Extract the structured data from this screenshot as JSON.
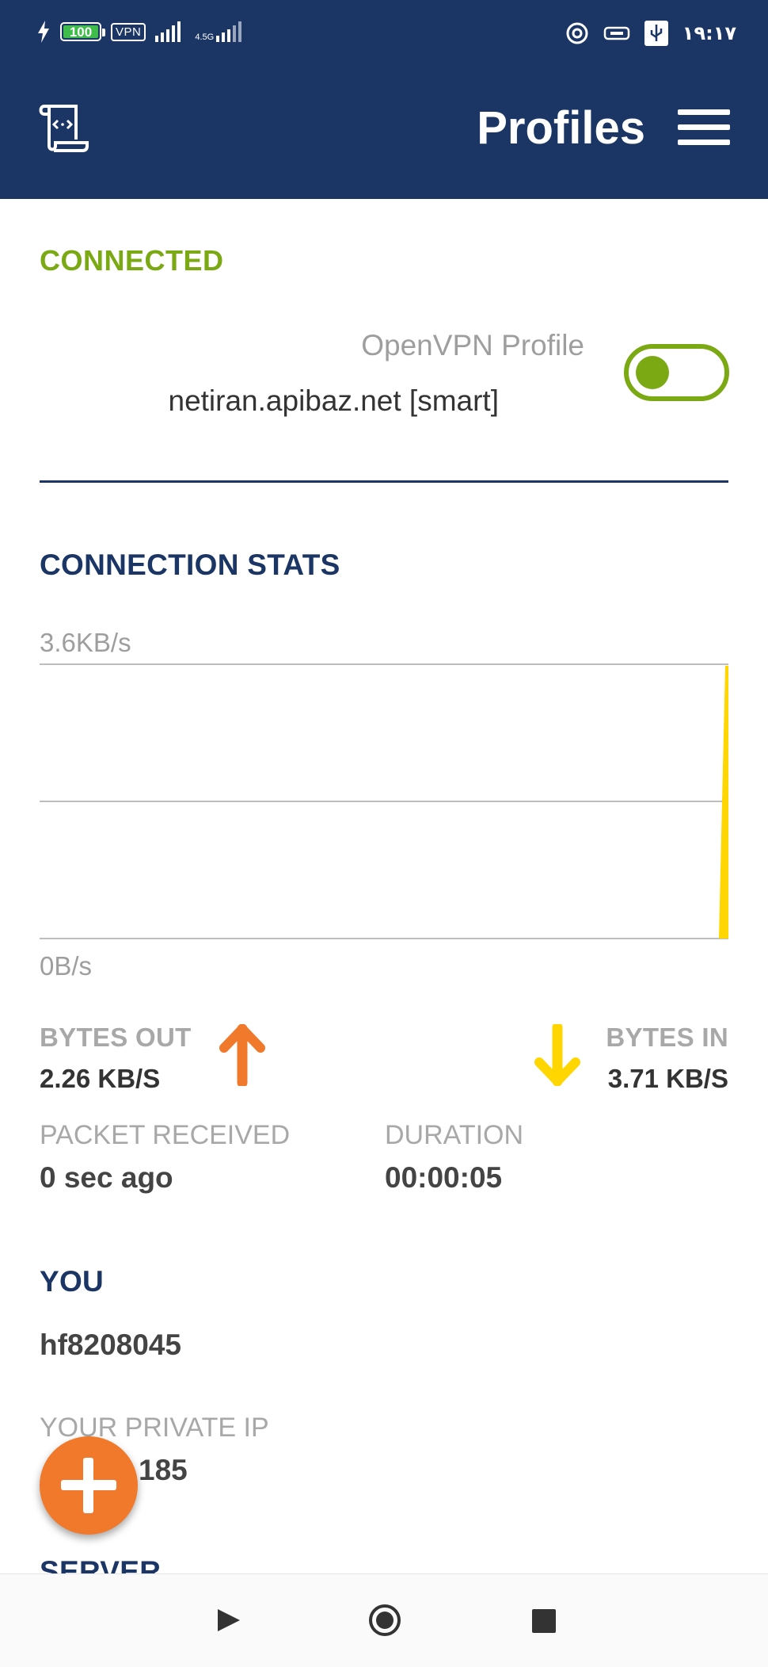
{
  "status_bar": {
    "battery": "100",
    "vpn_badge": "VPN",
    "network_label": "4.5G",
    "time": "١٩:١٧"
  },
  "header": {
    "title": "Profiles",
    "logo_icon": "scroll-code-icon",
    "menu_icon": "hamburger-menu-icon"
  },
  "connection": {
    "state": "CONNECTED",
    "profile_type": "OpenVPN Profile",
    "profile_name": "netiran.apibaz.net [smart]",
    "toggle_on": true,
    "accent_color": "#7aa913"
  },
  "stats": {
    "title": "CONNECTION STATS",
    "chart_data": {
      "type": "area",
      "title": "",
      "y_max_label": "3.6KB/s",
      "y_min_label": "0B/s",
      "ylim": [
        0,
        3.6
      ],
      "grid": true,
      "series": [
        {
          "color": "#ffd600",
          "values": [
            0,
            0,
            0,
            0,
            0,
            0,
            0,
            0,
            0,
            0,
            0,
            0,
            0,
            0,
            0,
            0,
            0,
            0,
            0,
            0,
            0,
            0,
            0,
            0,
            0,
            0,
            0,
            0,
            0,
            0,
            0,
            0,
            0,
            0,
            0,
            0,
            0,
            0,
            0,
            0,
            0,
            0,
            0,
            0,
            0,
            0,
            0,
            0,
            0,
            3.58
          ]
        }
      ]
    },
    "bytes_out_label": "BYTES OUT",
    "bytes_out_value": "2.26 KB/S",
    "bytes_out_color": "#f0792b",
    "bytes_in_label": "BYTES IN",
    "bytes_in_value": "3.71 KB/S",
    "bytes_in_color": "#ffd600",
    "packet_label": "PACKET RECEIVED",
    "packet_value": "0 sec ago",
    "duration_label": "DURATION",
    "duration_value": "00:00:05"
  },
  "you": {
    "title": "YOU",
    "username": "hf8208045",
    "private_ip_label": "YOUR PRIVATE IP",
    "private_ip_value": "185"
  },
  "server": {
    "title": "SERVER"
  },
  "fab": {
    "icon": "plus-icon"
  },
  "nav": {
    "back_icon": "play-icon",
    "home_icon": "home-circle-icon",
    "recent_icon": "stop-square-icon"
  },
  "colors": {
    "primary": "#1b3665",
    "connected": "#7aa913",
    "fab": "#f0792b"
  }
}
